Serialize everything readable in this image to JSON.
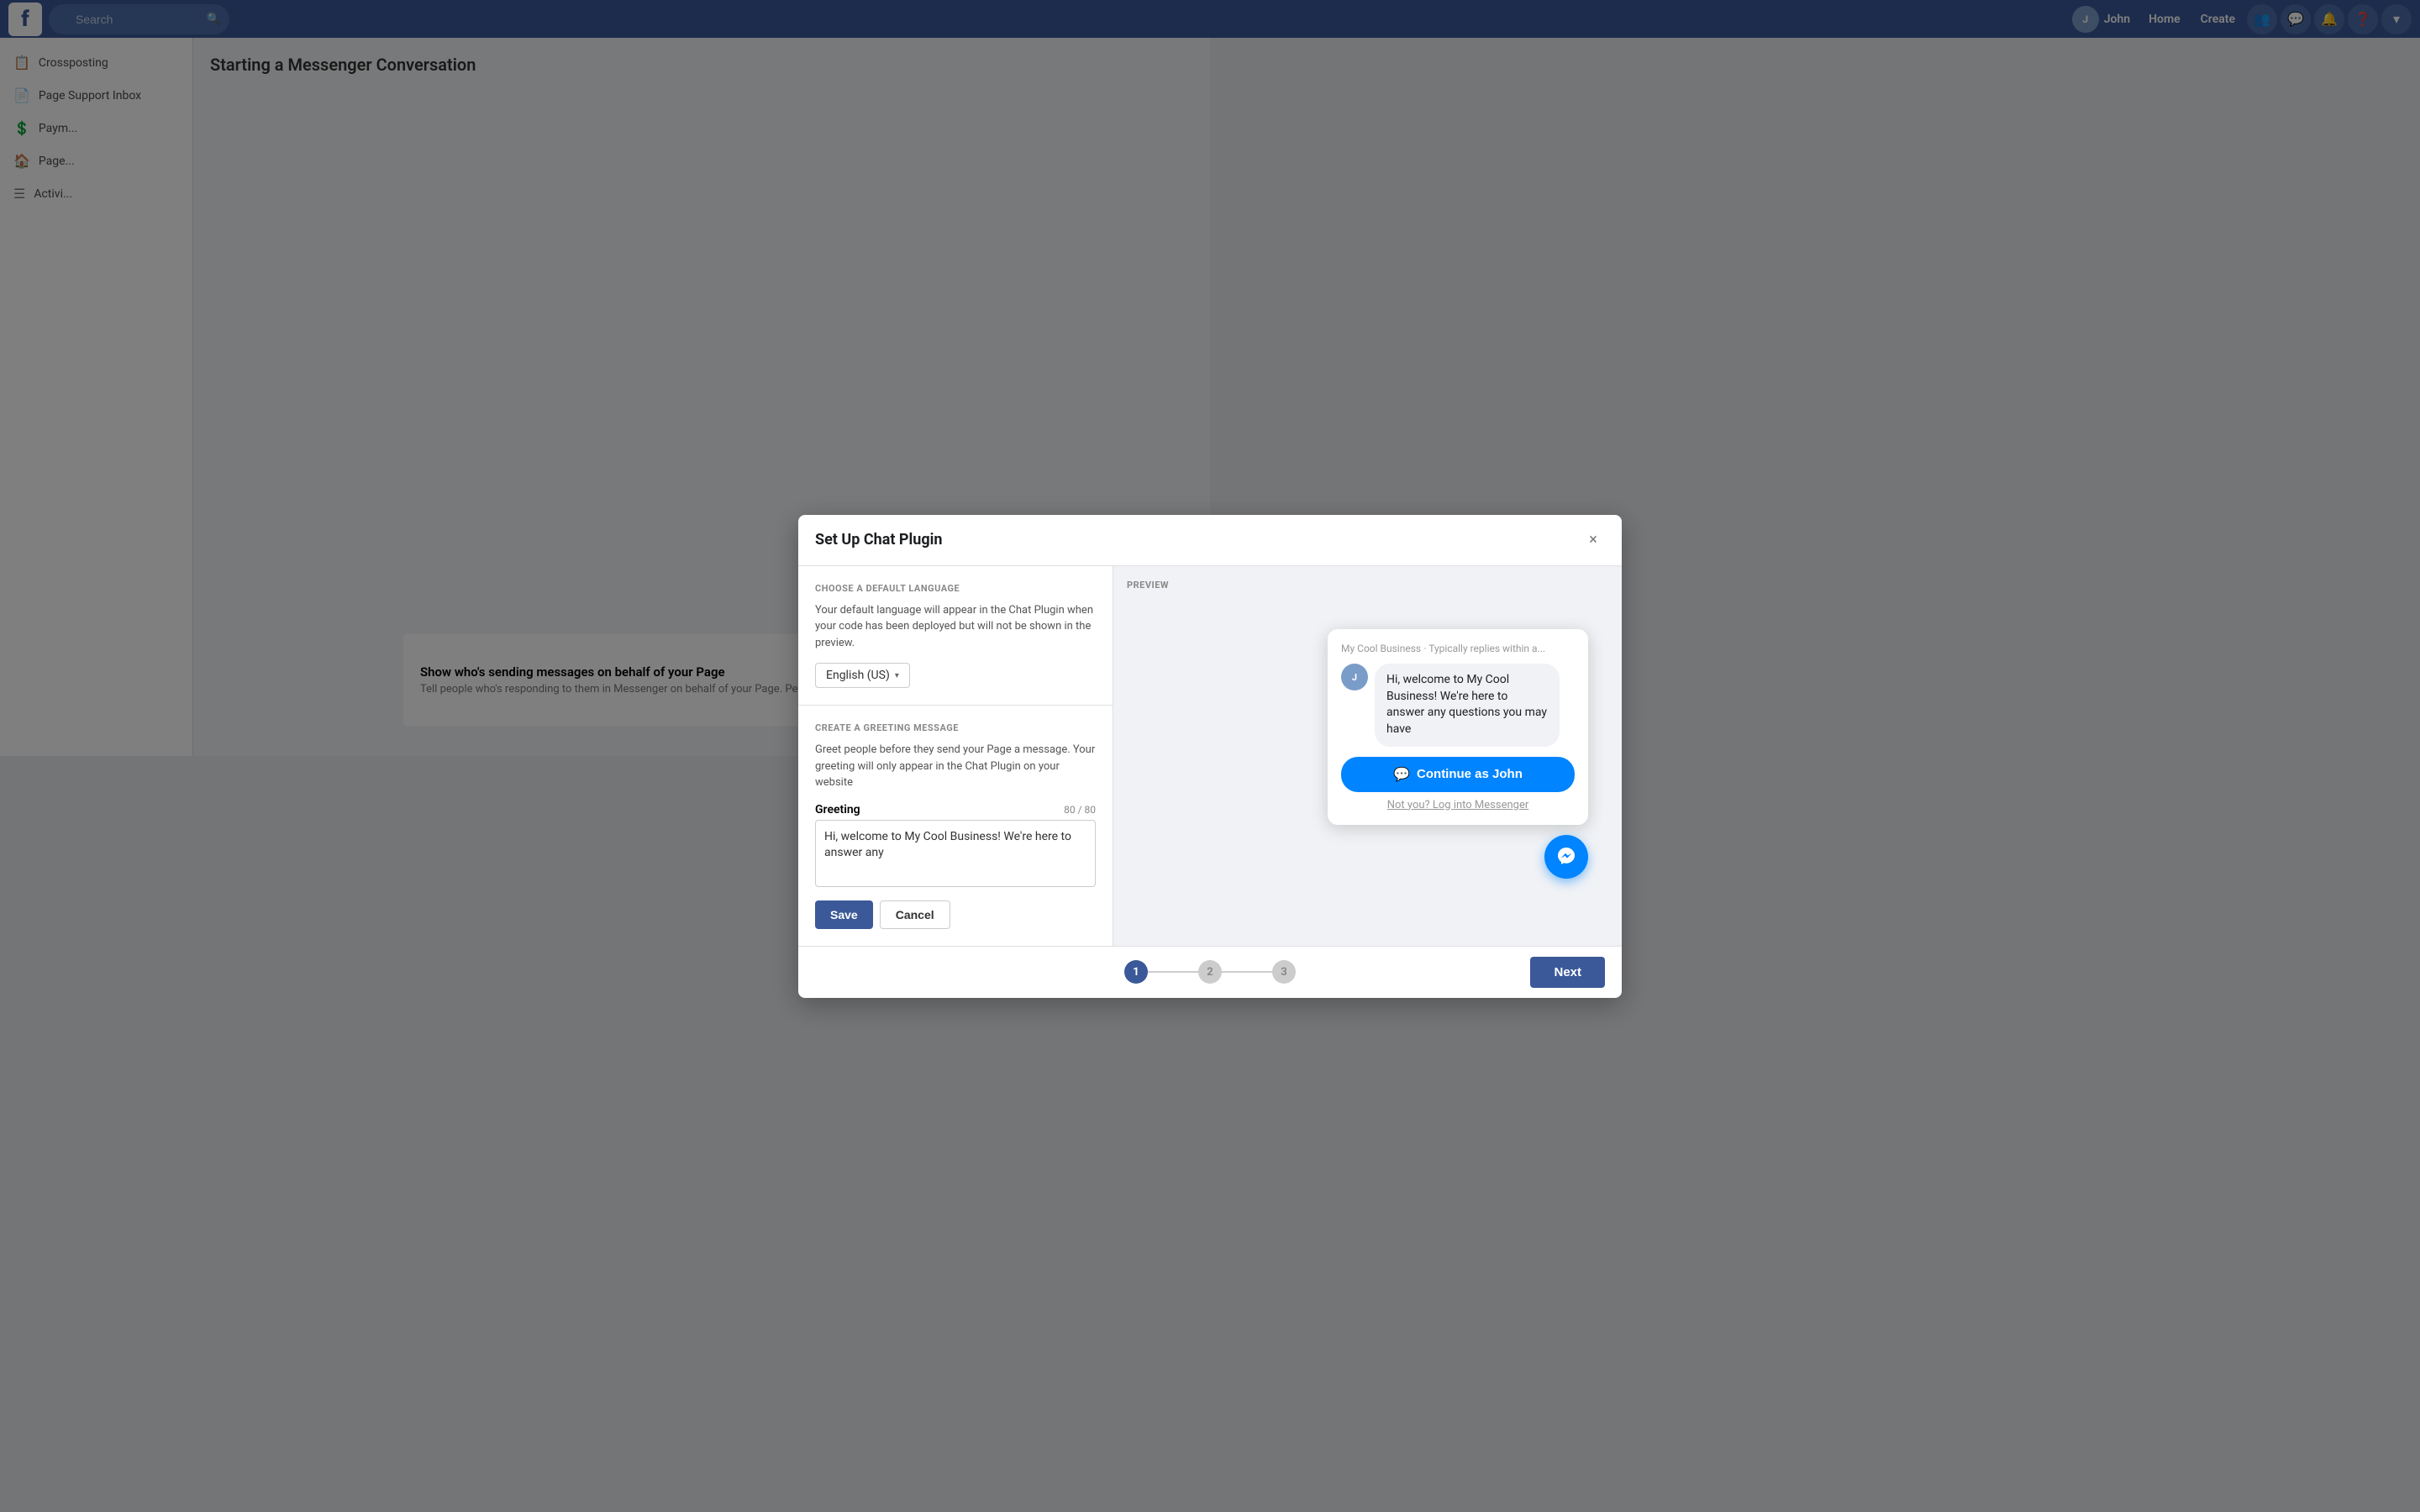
{
  "navbar": {
    "logo": "f",
    "search_placeholder": "Search",
    "user_name": "John",
    "links": [
      "Home",
      "Create"
    ],
    "icons": [
      "people-icon",
      "messenger-icon",
      "bell-icon",
      "help-icon",
      "chevron-icon"
    ]
  },
  "sidebar": {
    "items": [
      {
        "icon": "crosspost-icon",
        "label": "Crossposting"
      },
      {
        "icon": "support-icon",
        "label": "Page Support Inbox"
      },
      {
        "icon": "payment-icon",
        "label": "Paym..."
      },
      {
        "icon": "page-icon",
        "label": "Page..."
      },
      {
        "icon": "activity-icon",
        "label": "Activi..."
      }
    ]
  },
  "background": {
    "title": "Starting a Messenger Conversation"
  },
  "modal": {
    "title": "Set Up Chat Plugin",
    "close_label": "×",
    "left": {
      "choose_language_section": "CHOOSE A DEFAULT LANGUAGE",
      "language_desc": "Your default language will appear in the Chat Plugin when your code has been deployed but will not be shown in the preview.",
      "language_value": "English (US)",
      "greeting_section": "CREATE A GREETING MESSAGE",
      "greeting_desc": "Greet people before they send your Page a message. Your greeting will only appear in the Chat Plugin on your website",
      "greeting_label": "Greeting",
      "char_count": "80 / 80",
      "greeting_text": "Hi, welcome to My Cool Business! We're here to answer any",
      "save_label": "Save",
      "cancel_label": "Cancel"
    },
    "preview": {
      "label": "PREVIEW",
      "business_name": "My Cool Business",
      "reply_status": "· Typically replies within a...",
      "message": "Hi, welcome to My Cool Business! We're here to answer any questions you may have",
      "continue_btn": "Continue as John",
      "not_you": "Not you? Log into Messenger"
    },
    "footer": {
      "steps": [
        {
          "number": "1",
          "active": true
        },
        {
          "number": "2",
          "active": false
        },
        {
          "number": "3",
          "active": false
        }
      ],
      "next_label": "Next"
    }
  },
  "bottom_bar": {
    "toggle_label": "Show who's sending messages on behalf of your Page",
    "toggle_desc": "Tell people who's responding to them in Messenger on behalf of your Page. People can choose how their name appears.",
    "toggle_state": "Off"
  }
}
